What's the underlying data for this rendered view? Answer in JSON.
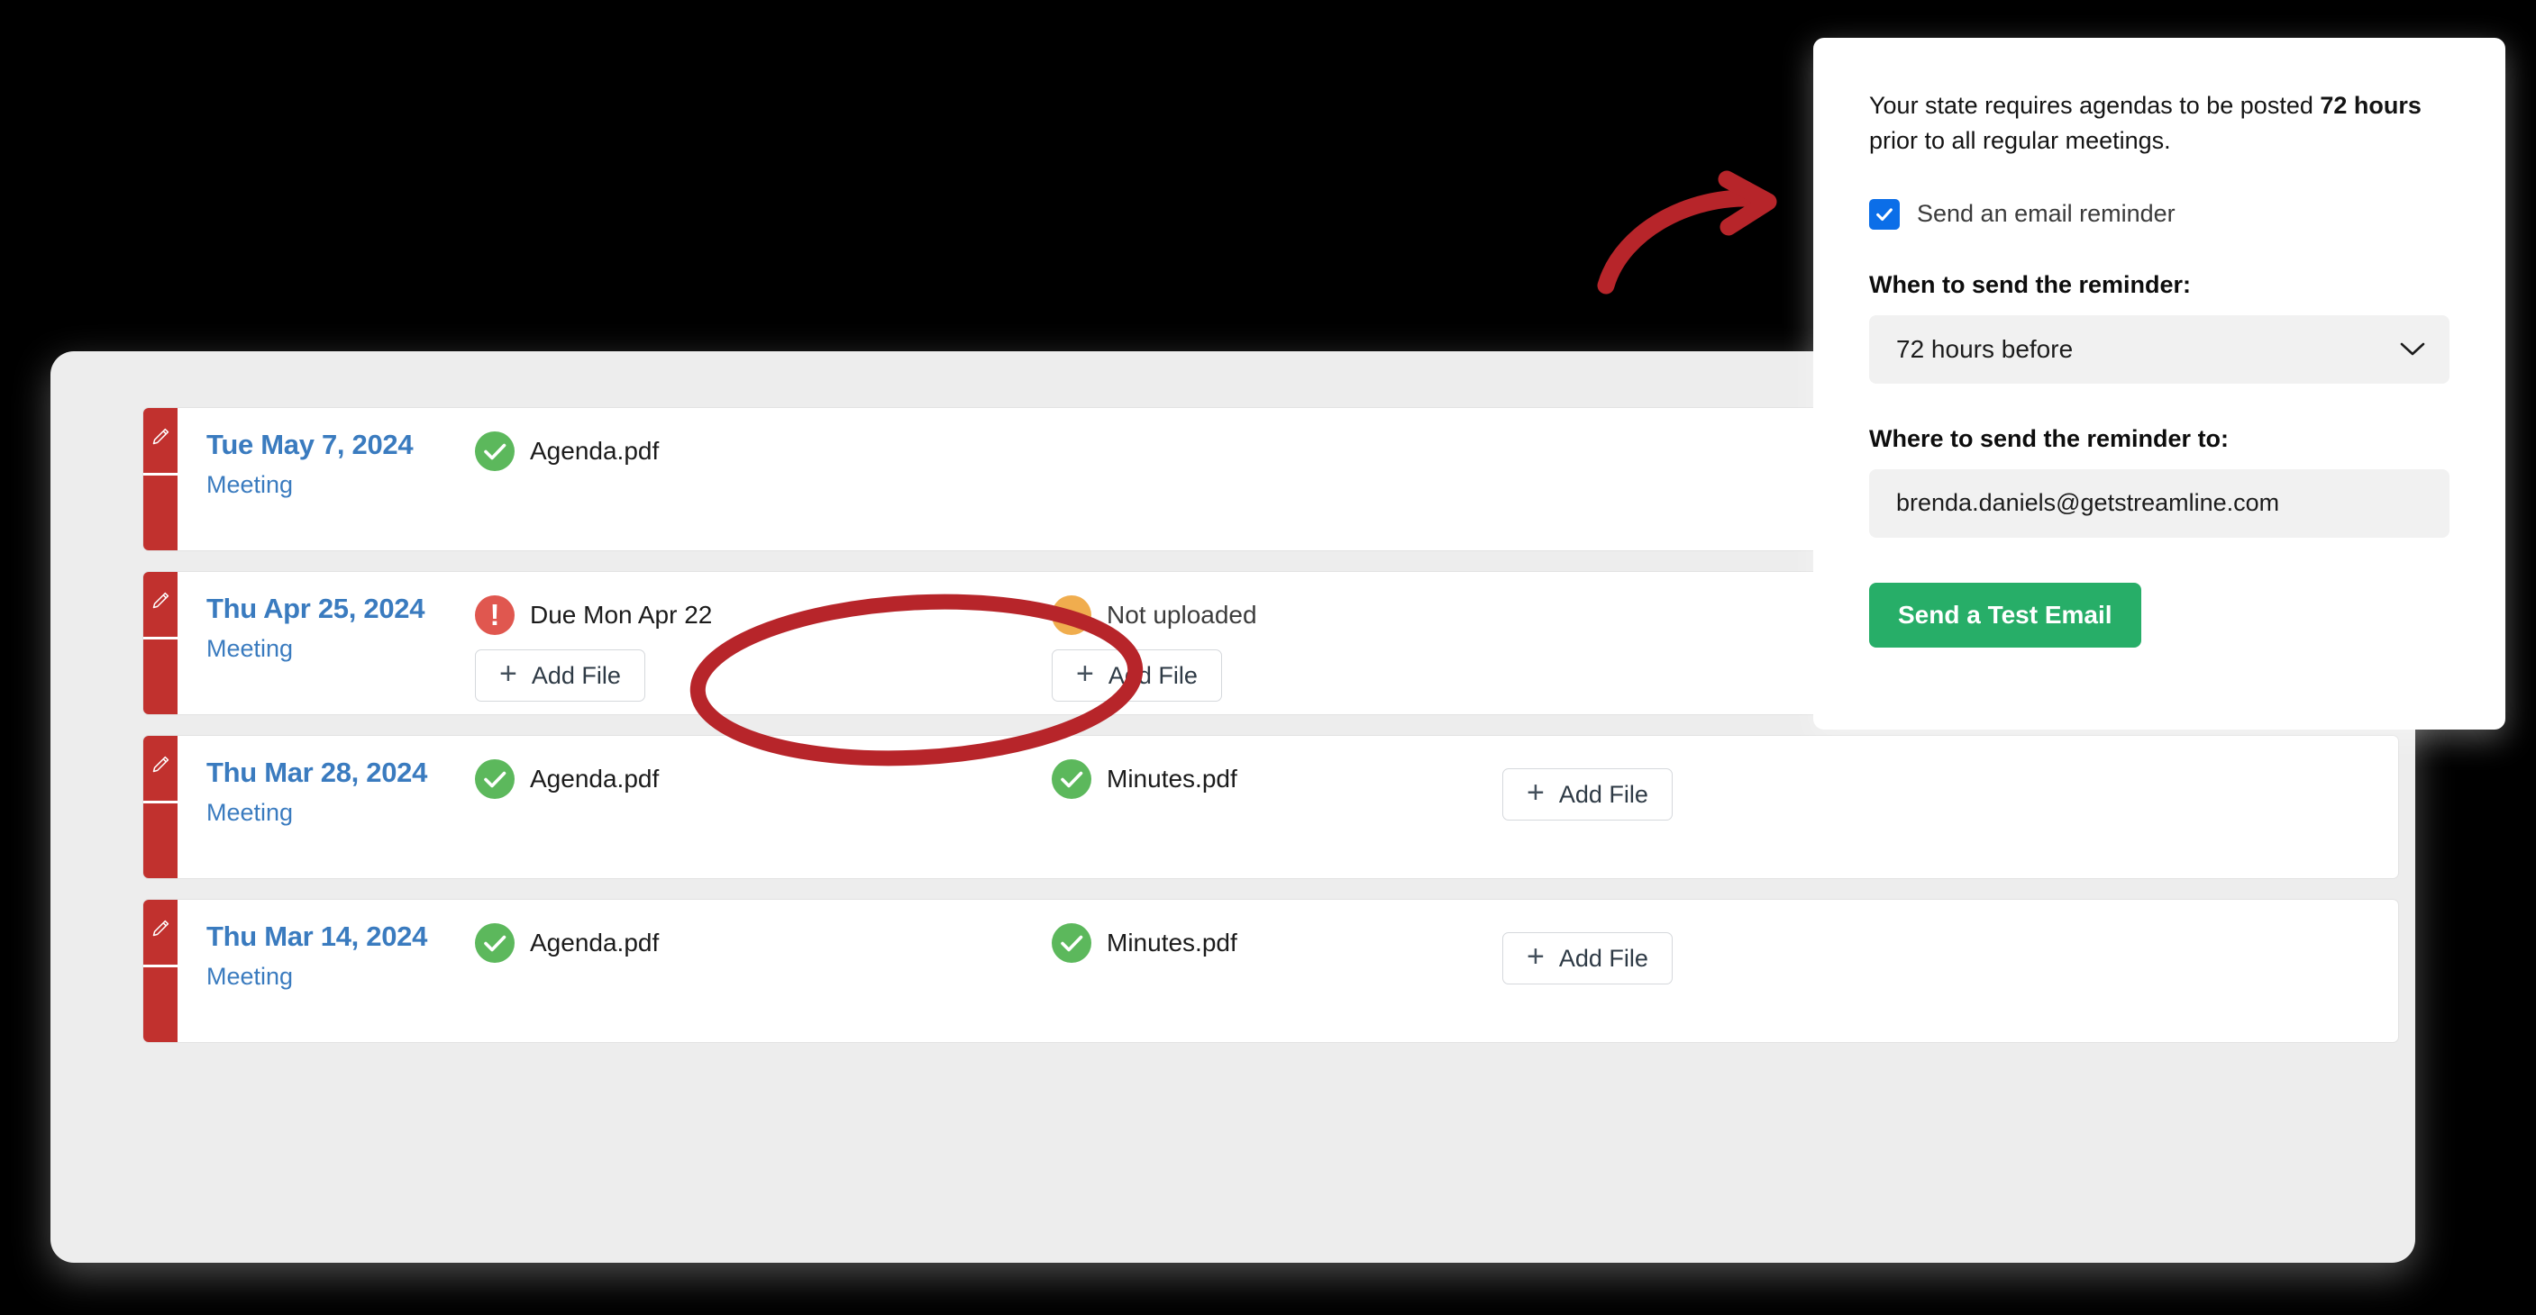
{
  "window": {
    "name": "meeting-documents-window"
  },
  "meetings": [
    {
      "date": "Tue May 7, 2024",
      "subtitle": "Meeting",
      "agenda": {
        "status": "uploaded",
        "label": "Agenda.pdf",
        "icon": "check-circle-icon"
      },
      "minutes": {
        "status": "hidden",
        "label": "",
        "icon": ""
      },
      "show_agenda_add": false,
      "show_minutes_add": false,
      "show_extra_add": false,
      "add_file_label": "Add File"
    },
    {
      "date": "Thu Apr 25, 2024",
      "subtitle": "Meeting",
      "agenda": {
        "status": "overdue",
        "label": "Due Mon Apr 22",
        "icon": "alert-circle-icon"
      },
      "minutes": {
        "status": "not-uploaded",
        "label": "Not uploaded",
        "icon": "pending-dot-icon"
      },
      "show_agenda_add": true,
      "show_minutes_add": true,
      "show_extra_add": false,
      "add_file_label": "Add File"
    },
    {
      "date": "Thu Mar 28, 2024",
      "subtitle": "Meeting",
      "agenda": {
        "status": "uploaded",
        "label": "Agenda.pdf",
        "icon": "check-circle-icon"
      },
      "minutes": {
        "status": "uploaded",
        "label": "Minutes.pdf",
        "icon": "check-circle-icon"
      },
      "show_agenda_add": false,
      "show_minutes_add": false,
      "show_extra_add": true,
      "add_file_label": "Add File"
    },
    {
      "date": "Thu Mar 14, 2024",
      "subtitle": "Meeting",
      "agenda": {
        "status": "uploaded",
        "label": "Agenda.pdf",
        "icon": "check-circle-icon"
      },
      "minutes": {
        "status": "uploaded",
        "label": "Minutes.pdf",
        "icon": "check-circle-icon"
      },
      "show_agenda_add": false,
      "show_minutes_add": false,
      "show_extra_add": true,
      "add_file_label": "Add File"
    }
  ],
  "reminder_panel": {
    "note_prefix": "Your state requires agendas to be posted ",
    "note_bold": "72 hours",
    "note_suffix": " prior to all regular meetings.",
    "checkbox_label": "Send an email reminder",
    "checkbox_checked": true,
    "when_label": "When to send the reminder:",
    "when_value": "72 hours before",
    "when_options": [
      "72 hours before"
    ],
    "where_label": "Where to send the reminder to:",
    "where_value": "brenda.daniels@getstreamline.com",
    "send_test_label": "Send a Test Email"
  },
  "annotations": {
    "arrow": "curved-red-arrow",
    "ellipse": "red-ellipse-highlight"
  },
  "colors": {
    "accent_red": "#c1312e",
    "link_blue": "#3a7bbf",
    "status_green": "#5cb85c",
    "status_orange": "#f0ad4e",
    "status_red": "#e0574f",
    "checkbox_blue": "#0b6ee8",
    "primary_green": "#27ae68",
    "annotation_red": "#b7252a"
  }
}
